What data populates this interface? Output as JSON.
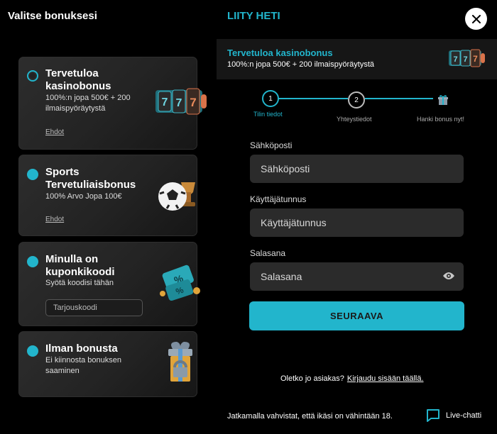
{
  "left": {
    "title": "Valitse bonuksesi"
  },
  "right": {
    "title": "LIITY HETI"
  },
  "close_symbol": "✕",
  "bonus_cards": [
    {
      "title": "Tervetuloa kasinobonus",
      "description": "100%:n jopa 500€ + 200 ilmaispyöräytystä",
      "link": "Ehdot",
      "selected": true,
      "art_icon": "slot-reels-icon"
    },
    {
      "title": "Sports Tervetuliaisbonus",
      "description": "100% Arvo Jopa 100€",
      "link": "Ehdot",
      "selected": false,
      "art_icon": "football-trophy-icon"
    },
    {
      "title": "Minulla on kuponkikoodi",
      "description": "Syötä koodisi tähän",
      "input_placeholder": "Tarjouskoodi",
      "selected": false,
      "art_icon": "coupon-tickets-icon"
    },
    {
      "title": "Ilman bonusta",
      "description": "Ei kiinnosta bonuksen saaminen",
      "selected": false,
      "art_icon": "gift-box-icon"
    }
  ],
  "banner": {
    "title": "Tervetuloa kasinobonus",
    "description": "100%:n jopa 500€ + 200 ilmaispyöräytystä",
    "art_icon": "slot-reels-icon"
  },
  "steps": [
    {
      "number": "1",
      "label": "Tilin tiedot",
      "active": true
    },
    {
      "number": "2",
      "label": "Yhteystiedot",
      "active": false
    },
    {
      "icon": "gift-icon",
      "label": "Hanki bonus nyt!",
      "active": false
    }
  ],
  "form": {
    "email_label": "Sähköposti",
    "email_placeholder": "Sähköposti",
    "username_label": "Käyttäjätunnus",
    "username_placeholder": "Käyttäjätunnus",
    "password_label": "Salasana",
    "password_placeholder": "Salasana",
    "submit_label": "SEURAAVA"
  },
  "footer": {
    "login_prompt": "Oletko jo asiakas?",
    "login_link": "Kirjaudu sisään täällä.",
    "age_notice": "Jatkamalla vahvistat, että ikäsi on vähintään 18.",
    "chat_label": "Live-chatti"
  },
  "colors": {
    "accent": "#22b5cc",
    "background": "#000000",
    "card": "#262626",
    "input": "#2b2b2b"
  }
}
